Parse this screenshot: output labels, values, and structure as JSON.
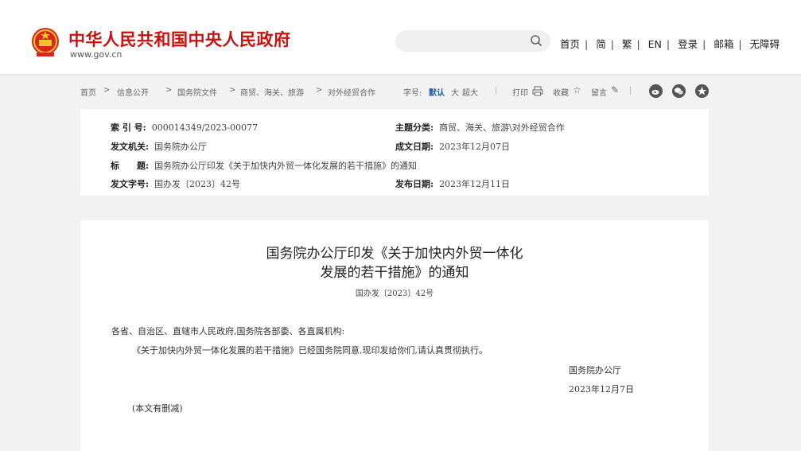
{
  "brand": {
    "title": "中华人民共和国中央人民政府",
    "url": "www.gov.cn"
  },
  "search": {
    "placeholder": ""
  },
  "topnav": [
    "首页",
    "简",
    "繁",
    "EN",
    "登录",
    "邮箱",
    "无障碍"
  ],
  "breadcrumb": [
    "首页",
    "信息公开",
    "国务院文件",
    "商贸、海关、旅游",
    "对外经贸合作"
  ],
  "toolbar": {
    "font_label": "字号:",
    "font_default": "默认",
    "font_large": "大",
    "font_xlarge": "超大",
    "print": "打印",
    "favorite": "收藏",
    "comment": "留言"
  },
  "meta": {
    "index_label": "索 引 号:",
    "index_value": "000014349/2023-00077",
    "topic_label": "主题分类:",
    "topic_value": "商贸、海关、旅游\\对外经贸合作",
    "issuer_label": "发文机关:",
    "issuer_value": "国务院办公厅",
    "date_label": "成文日期:",
    "date_value": "2023年12月07日",
    "title_label": "标　　题:",
    "title_value": "国务院办公厅印发《关于加快内外贸一体化发展的若干措施》的通知",
    "docno_label": "发文字号:",
    "docno_value": "国办发〔2023〕42号",
    "pub_label": "发布日期:",
    "pub_value": "2023年12月11日"
  },
  "doc": {
    "title_line1": "国务院办公厅印发《关于加快内外贸一体化",
    "title_line2": "发展的若干措施》的通知",
    "number": "国办发〔2023〕42号",
    "salutation": "各省、自治区、直辖市人民政府,国务院各部委、各直属机构:",
    "body": "《关于加快内外贸一体化发展的若干措施》已经国务院同意,现印发给你们,请认真贯彻执行。",
    "sign_org": "国务院办公厅",
    "sign_date": "2023年12月7日",
    "note": "(本文有删减)"
  },
  "colors": {
    "brand_red": "#c7120f",
    "page_bg": "#f2f2f2"
  }
}
